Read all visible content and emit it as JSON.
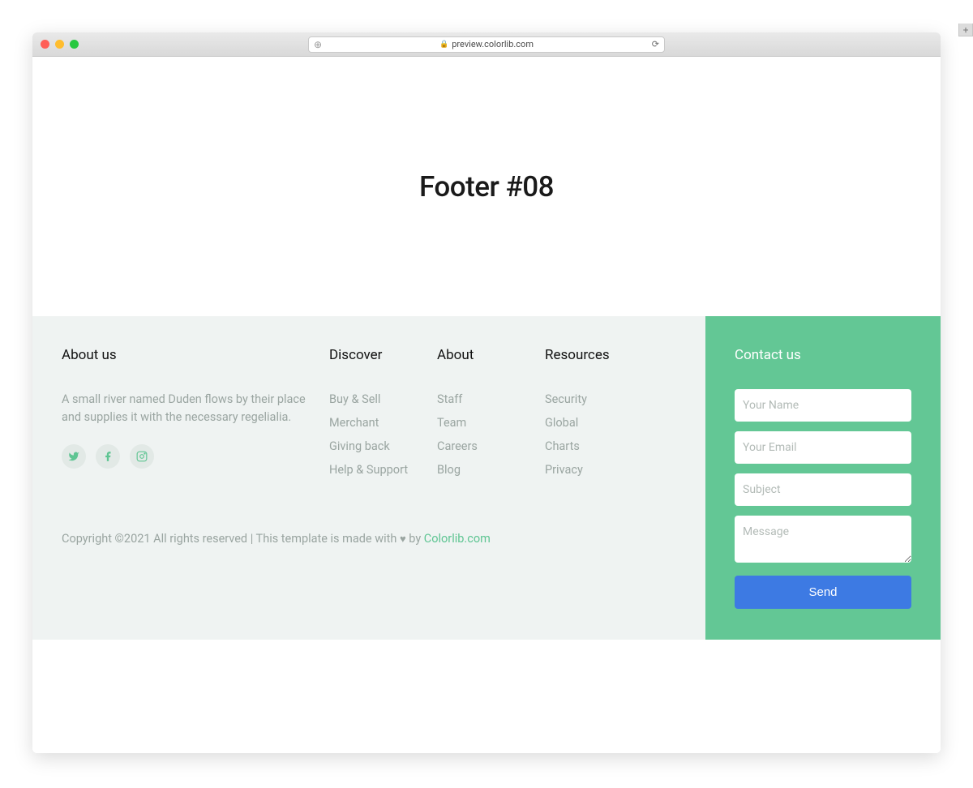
{
  "browser": {
    "url": "preview.colorlib.com"
  },
  "hero": {
    "title": "Footer #08"
  },
  "footer": {
    "about": {
      "heading": "About us",
      "text": "A small river named Duden flows by their place and supplies it with the necessary regelialia."
    },
    "columns": {
      "discover": {
        "heading": "Discover",
        "links": [
          "Buy & Sell",
          "Merchant",
          "Giving back",
          "Help & Support"
        ]
      },
      "about": {
        "heading": "About",
        "links": [
          "Staff",
          "Team",
          "Careers",
          "Blog"
        ]
      },
      "resources": {
        "heading": "Resources",
        "links": [
          "Security",
          "Global",
          "Charts",
          "Privacy"
        ]
      }
    },
    "contact": {
      "heading": "Contact us",
      "name_placeholder": "Your Name",
      "email_placeholder": "Your Email",
      "subject_placeholder": "Subject",
      "message_placeholder": "Message",
      "send_label": "Send"
    },
    "copyright": {
      "prefix": "Copyright ©2021 All rights reserved | This template is made with ",
      "by": " by ",
      "link_label": "Colorlib.com"
    }
  }
}
